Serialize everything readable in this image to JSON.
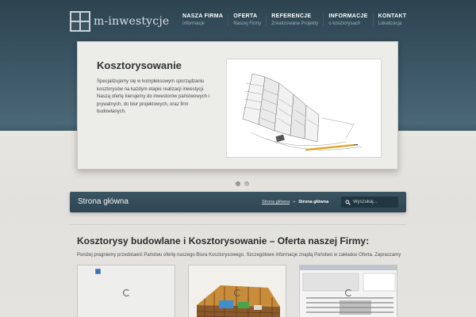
{
  "brand": {
    "logo_text": "m-inwestycje"
  },
  "nav": [
    {
      "title": "NASZA FIRMA",
      "sub": "Informacje"
    },
    {
      "title": "OFERTA",
      "sub": "Naszej Firmy"
    },
    {
      "title": "REFERENCJE",
      "sub": "Zrealizowane Projekty"
    },
    {
      "title": "INFORMACJE",
      "sub": "o kosztorysach"
    },
    {
      "title": "KONTAKT",
      "sub": "Lokalizacja"
    }
  ],
  "slider": {
    "title": "Kosztorysowanie",
    "text": "Specjalizujemy się w kompleksowym sporządzaniu kosztorysów na każdym etapie realizacji inwestycji. Naszą ofertę kierujemy do inwestorów państwowych i prywatnych, do biur projektowych, oraz firm budowlanych.",
    "image_icon": "building-sketch-image",
    "slide_count": 2,
    "active_slide": 1
  },
  "breadcrumb": {
    "page_title": "Strona główna",
    "home_link": "Strona główna",
    "separator": "»",
    "current": "Strona główna",
    "search_placeholder": "Wyszukaj..."
  },
  "content": {
    "heading": "Kosztorysy budowlane i Kosztorysowanie – Oferta naszej Firmy:",
    "intro": "Poniżej pragniemy przedstawić Państwu ofertę naszego Biura Kosztorysowego. Szczegółowe informacje znajdą Państwo w zakładce Oferta. Zapraszamy"
  },
  "colors": {
    "header": "#2d4350",
    "breadcrumb_bar": "#2e4553",
    "page_background": "#e4e3df"
  }
}
